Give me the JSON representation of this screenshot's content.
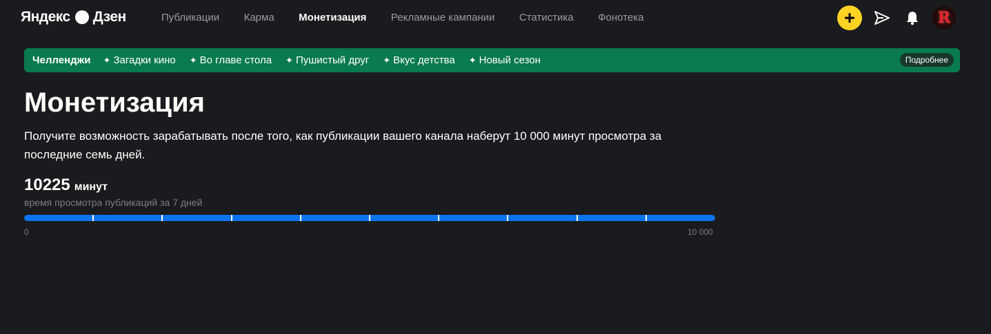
{
  "header": {
    "logo_left": "Яндекс",
    "logo_right": "Дзен",
    "nav": [
      {
        "label": "Публикации",
        "active": false
      },
      {
        "label": "Карма",
        "active": false
      },
      {
        "label": "Монетизация",
        "active": true
      },
      {
        "label": "Рекламные кампании",
        "active": false
      },
      {
        "label": "Статистика",
        "active": false
      },
      {
        "label": "Фонотека",
        "active": false
      }
    ],
    "avatar_letter": "R"
  },
  "challenges": {
    "title": "Челленджи",
    "items": [
      "Загадки кино",
      "Во главе стола",
      "Пушистый друг",
      "Вкус детства",
      "Новый сезон"
    ],
    "more_label": "Подробнее",
    "color": "#0a7a4f"
  },
  "main": {
    "title": "Монетизация",
    "description": "Получите возможность зарабатывать после того, как публикации вашего канала наберут 10 000 минут просмотра за последние семь дней.",
    "stat_value": "10225",
    "stat_unit": "минут",
    "stat_caption": "время просмотра публикаций за 7 дней",
    "progress": {
      "fraction": 1.0,
      "segments": 10,
      "min_label": "0",
      "max_label": "10 000",
      "color": "#0b75f0"
    }
  },
  "colors": {
    "background": "#1a1b1e",
    "accent_yellow": "#ffd323"
  }
}
